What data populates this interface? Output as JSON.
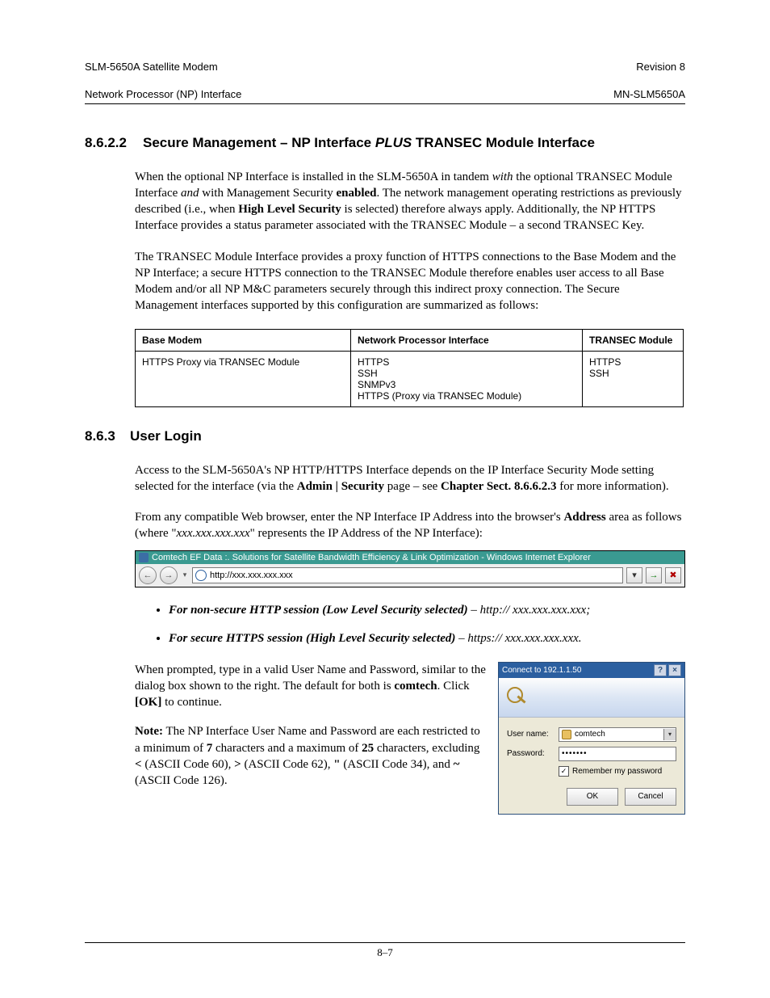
{
  "header": {
    "left_line1": "SLM-5650A Satellite Modem",
    "left_line2": "Network Processor (NP) Interface",
    "right_line1": "Revision 8",
    "right_line2": "MN-SLM5650A"
  },
  "section1": {
    "number": "8.6.2.2",
    "title_pre": "Secure Management – NP Interface ",
    "title_em": "PLUS",
    "title_post": " TRANSEC Module Interface"
  },
  "para1": {
    "t1": "When the optional NP Interface is installed in the SLM-5650A in tandem ",
    "em1": "with",
    "t2": " the optional TRANSEC Module Interface ",
    "em2": "and",
    "t3": " with Management Security ",
    "b1": "enabled",
    "t4": ". The network management operating restrictions as previously described (i.e., when ",
    "b2": "High Level Security",
    "t5": " is selected) therefore always apply. Additionally, the NP HTTPS Interface provides a status parameter associated with the TRANSEC Module – a second TRANSEC Key."
  },
  "para2": "The TRANSEC Module Interface provides a proxy function of HTTPS connections to the Base Modem and the NP Interface; a secure HTTPS connection to the TRANSEC Module therefore enables user access to all Base Modem and/or all NP M&C parameters securely through this indirect proxy connection. The Secure Management interfaces supported by this configuration are summarized as follows:",
  "table": {
    "h1": "Base Modem",
    "h2": "Network Processor Interface",
    "h3": "TRANSEC Module",
    "c1": "HTTPS Proxy via TRANSEC Module",
    "c2": "HTTPS\nSSH\nSNMPv3\nHTTPS (Proxy via TRANSEC Module)",
    "c3": "HTTPS\nSSH"
  },
  "section2": {
    "number": "8.6.3",
    "title": "User Login"
  },
  "para3": {
    "t1": "Access to the SLM-5650A's NP HTTP/HTTPS Interface depends on the IP Interface Security Mode setting selected for the interface (via the ",
    "b1": "Admin | Security",
    "t2": " page – see ",
    "b2": "Chapter Sect. 8.6.6.2.3",
    "t3": " for more information)."
  },
  "para4": {
    "t1": "From any compatible Web browser, enter the NP Interface IP Address into the browser's ",
    "b1": "Address",
    "t2": " area as follows (where \"",
    "em1": "xxx.xxx.xxx.xxx",
    "t3": "\" represents the IP Address of the NP Interface):"
  },
  "browser": {
    "title": "Comtech EF Data :. Solutions for Satellite Bandwidth Efficiency & Link Optimization - Windows Internet Explorer",
    "url": "http://xxx.xxx.xxx.xxx"
  },
  "bullets": {
    "b1_lead": "For non-secure HTTP session (Low Level Security selected)",
    "b1_tail": " – http:// xxx.xxx.xxx.xxx;",
    "b2_lead": "For secure HTTPS session (High Level Security selected)",
    "b2_tail": " – https:// xxx.xxx.xxx.xxx."
  },
  "para5": {
    "t1": "When prompted, type in a valid User Name and Password, similar to the dialog box shown to the right. The default for both is ",
    "b1": "comtech",
    "t2": ". Click ",
    "b2": "[OK]",
    "t3": " to continue."
  },
  "para6": {
    "b0": "Note:",
    "t1": " The NP Interface User Name and Password are each restricted to a minimum of ",
    "b1": "7",
    "t2": " characters and a maximum of ",
    "b2": "25",
    "t3": " characters, excluding ",
    "b3": "<",
    "t4": " (ASCII Code 60), ",
    "b4": ">",
    "t5": " (ASCII Code 62), ",
    "b5": "\"",
    "t6": " (ASCII Code 34), and ",
    "b6": "~",
    "t7": " (ASCII Code 126)."
  },
  "login": {
    "title": "Connect to 192.1.1.50",
    "help": "?",
    "close": "×",
    "user_label": "User name:",
    "user_value": "comtech",
    "pass_label": "Password:",
    "pass_value": "•••••••",
    "remember": "Remember my password",
    "ok": "OK",
    "cancel": "Cancel"
  },
  "footer": "8–7"
}
